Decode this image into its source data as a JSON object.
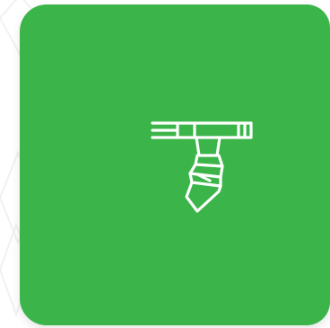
{
  "tile": {
    "color": "#3bb54a",
    "icon": "pipe-leak-icon",
    "icon_color": "#ffffff"
  },
  "background": {
    "color": "#ffffff",
    "pattern_color": "#f1f1f1"
  }
}
